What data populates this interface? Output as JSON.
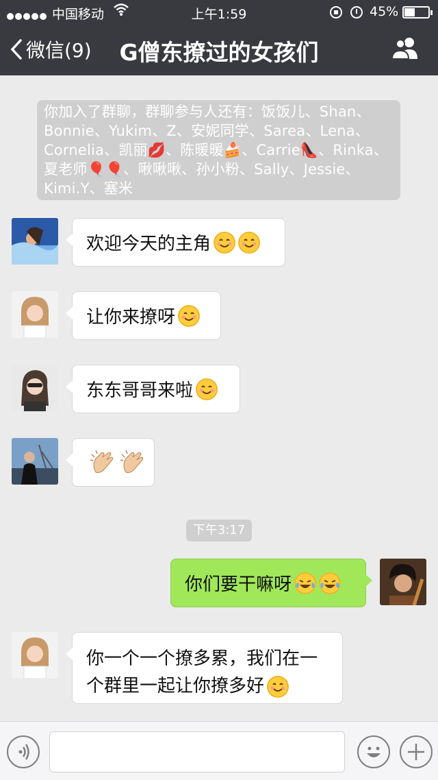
{
  "status_bar": {
    "carrier": "中国移动",
    "time": "上午1:59",
    "battery_percent": "45%",
    "battery_level": 0.45
  },
  "nav": {
    "back_label": "微信(9)",
    "title": "G僧东撩过的女孩们"
  },
  "system_message": "你加入了群聊，群聊参与人还有：饭饭儿、Shan、Bonnie、Yukim、Z、安妮同学、Sarea、Lena、Cornelia、凯丽💋、陈暖暖🍰、Carrie👠、Rinka、夏老师🎈🎈、啾啾啾、孙小粉、Sally、Jessie、Kimi.Y、塞米",
  "timestamp": "下午3:17",
  "messages": [
    {
      "text": "欢迎今天的主角",
      "emoji": [
        "smile",
        "smile"
      ]
    },
    {
      "text": "让你来撩呀",
      "emoji": [
        "smile"
      ]
    },
    {
      "text": "东东哥哥来啦",
      "emoji": [
        "smile"
      ]
    },
    {
      "text": "",
      "emoji": [
        "clap",
        "clap"
      ]
    },
    {
      "text": "你们要干嘛呀",
      "emoji": [
        "tears-of-joy",
        "tears-of-joy"
      ]
    },
    {
      "text": "你一个一个撩多累，我们在一个群里一起让你撩多好",
      "emoji": [
        "smile"
      ]
    }
  ],
  "colors": {
    "header_bg": "#393a3f",
    "chat_bg": "#ebebeb",
    "own_bubble": "#a0e75a",
    "other_bubble": "#ffffff"
  },
  "input": {
    "placeholder": ""
  }
}
